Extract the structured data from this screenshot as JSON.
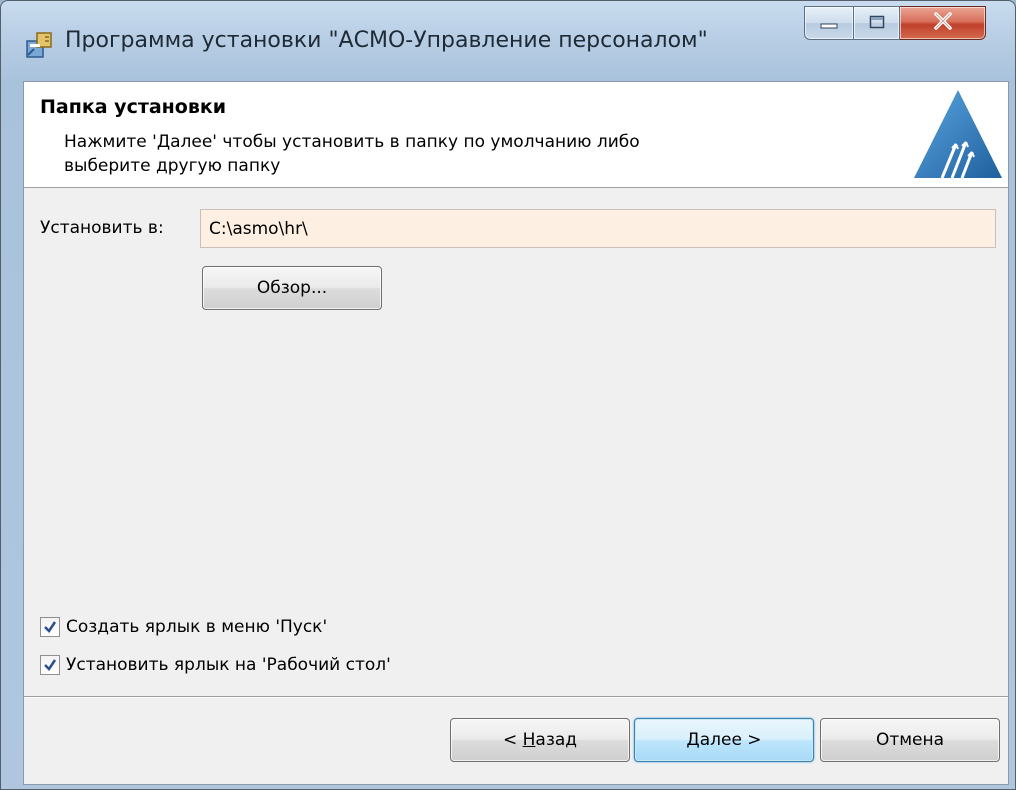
{
  "window": {
    "title": "Программа установки \"АСМО-Управление персоналом\"",
    "icons": {
      "app": "installer-icon",
      "minimize": "minimize-icon",
      "maximize": "maximize-icon",
      "close": "close-icon"
    }
  },
  "header": {
    "title": "Папка установки",
    "description_line1": "Нажмите 'Далее' чтобы установить в папку по умолчанию либо",
    "description_line2": "выберите другую папку",
    "logo": "asmo-logo"
  },
  "form": {
    "install_label": "Установить в:",
    "install_path": "C:\\asmo\\hr\\",
    "browse_label": "Обзор..."
  },
  "options": [
    {
      "label": "Создать ярлык в меню 'Пуск'",
      "checked": true
    },
    {
      "label": "Установить ярлык на 'Рабочий стол'",
      "checked": true
    }
  ],
  "footer": {
    "back_prefix": "< ",
    "back_accel": "Н",
    "back_rest": "азад",
    "next_label": "Далее >",
    "cancel_label": "Отмена"
  },
  "colors": {
    "input_background": "#fdf0e2",
    "logo_blue": "#2a76b8",
    "default_button_border": "#3c7fb1"
  }
}
